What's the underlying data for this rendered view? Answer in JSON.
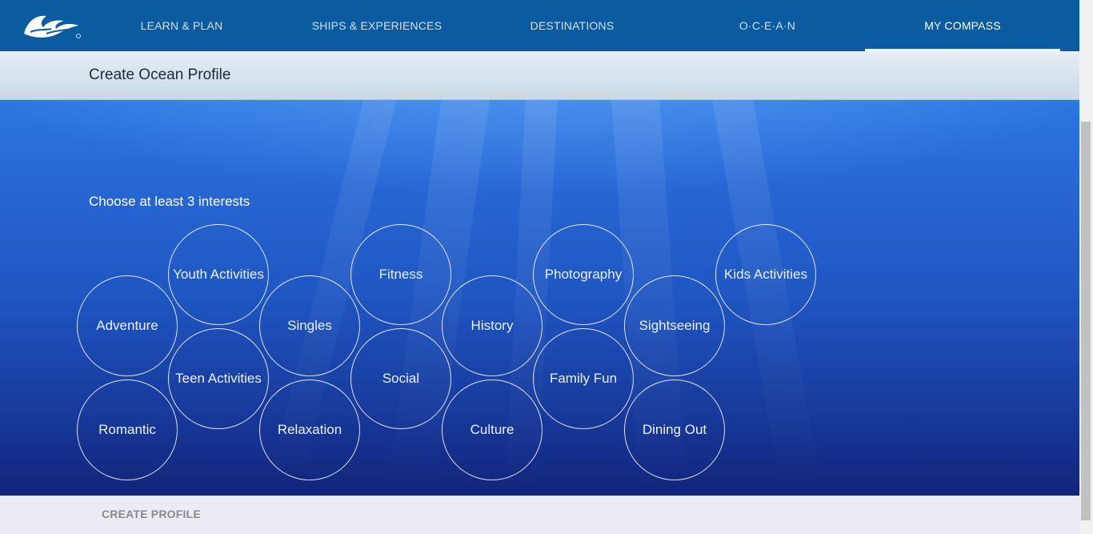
{
  "nav": {
    "logo": {
      "icon": "princess-seawitch-logo-icon"
    },
    "items": [
      {
        "label": "LEARN & PLAN"
      },
      {
        "label": "SHIPS & EXPERIENCES"
      },
      {
        "label": "DESTINATIONS"
      },
      {
        "label": "O·C·E·A·N"
      },
      {
        "label": "MY COMPASS",
        "active": true
      }
    ]
  },
  "header": {
    "title": "Create Ocean Profile"
  },
  "interests": {
    "instruction": "Choose at least 3 interests",
    "items": [
      {
        "label": "Youth Activities"
      },
      {
        "label": "Fitness"
      },
      {
        "label": "Photography"
      },
      {
        "label": "Kids Activities"
      },
      {
        "label": "Adventure"
      },
      {
        "label": "Singles"
      },
      {
        "label": "History"
      },
      {
        "label": "Sightseeing"
      },
      {
        "label": "Teen Activities"
      },
      {
        "label": "Social"
      },
      {
        "label": "Family Fun"
      },
      {
        "label": "Romantic"
      },
      {
        "label": "Relaxation"
      },
      {
        "label": "Culture"
      },
      {
        "label": "Dining Out"
      }
    ]
  },
  "footer": {
    "create_label": "CREATE PROFILE"
  },
  "colors": {
    "nav_bg": "#0b5ba1",
    "hero_top": "#2f7fe8",
    "hero_bottom": "#12247a"
  }
}
